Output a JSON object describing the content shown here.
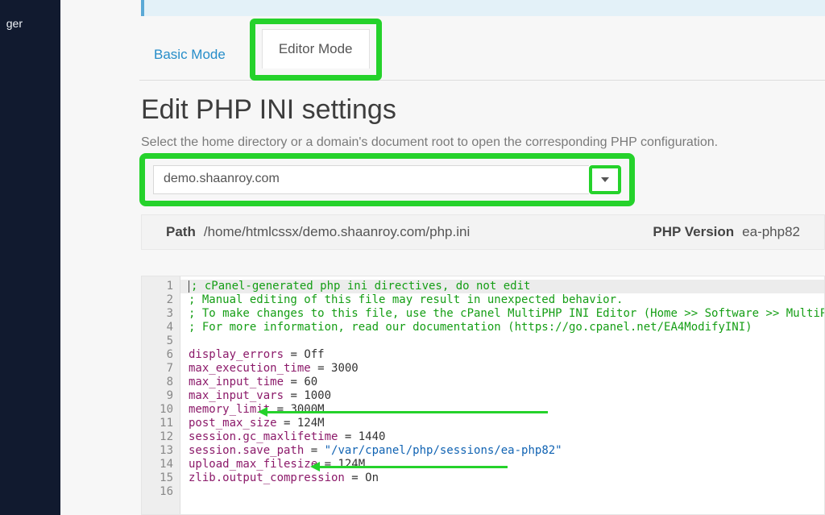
{
  "sidebar": {
    "partial_text": "ger"
  },
  "tabs": {
    "basic": "Basic Mode",
    "editor": "Editor Mode"
  },
  "heading": "Edit PHP INI settings",
  "subheading": "Select the home directory or a domain's document root to open the corresponding PHP configuration.",
  "domain_select": {
    "value": "demo.shaanroy.com"
  },
  "path_row": {
    "path_label": "Path",
    "path_value": "/home/htmlcssx/demo.shaanroy.com/php.ini",
    "version_label": "PHP Version",
    "version_value": "ea-php82"
  },
  "editor": {
    "gutter": [
      "1",
      "2",
      "3",
      "4",
      "5",
      "6",
      "7",
      "8",
      "9",
      "10",
      "11",
      "12",
      "13",
      "14",
      "15",
      "16"
    ],
    "lines": [
      {
        "type": "comment",
        "text": "; cPanel-generated php ini directives, do not edit",
        "hl": true,
        "cursor": true
      },
      {
        "type": "comment",
        "text": "; Manual editing of this file may result in unexpected behavior."
      },
      {
        "type": "comment",
        "text": "; To make changes to this file, use the cPanel MultiPHP INI Editor (Home >> Software >> MultiPHP INI Editor)"
      },
      {
        "type": "comment",
        "text": "; For more information, read our documentation (https://go.cpanel.net/EA4ModifyINI)"
      },
      {
        "type": "blank"
      },
      {
        "type": "kv",
        "key": "display_errors",
        "val": "Off"
      },
      {
        "type": "kv",
        "key": "max_execution_time",
        "val": "3000"
      },
      {
        "type": "kv",
        "key": "max_input_time",
        "val": "60"
      },
      {
        "type": "kv",
        "key": "max_input_vars",
        "val": "1000"
      },
      {
        "type": "kv",
        "key": "memory_limit",
        "val": "3000M"
      },
      {
        "type": "kv",
        "key": "post_max_size",
        "val": "124M"
      },
      {
        "type": "kv",
        "key": "session.gc_maxlifetime",
        "val": "1440"
      },
      {
        "type": "kv_str",
        "key": "session.save_path",
        "val": "\"/var/cpanel/php/sessions/ea-php82\""
      },
      {
        "type": "kv",
        "key": "upload_max_filesize",
        "val": "124M"
      },
      {
        "type": "kv",
        "key": "zlib.output_compression",
        "val": "On"
      },
      {
        "type": "blank"
      }
    ]
  },
  "highlights": {
    "editor_tab_box": "green-box",
    "domain_select_box": "green-box",
    "arrows_point_to": [
      "memory_limit",
      "upload_max_filesize"
    ]
  }
}
